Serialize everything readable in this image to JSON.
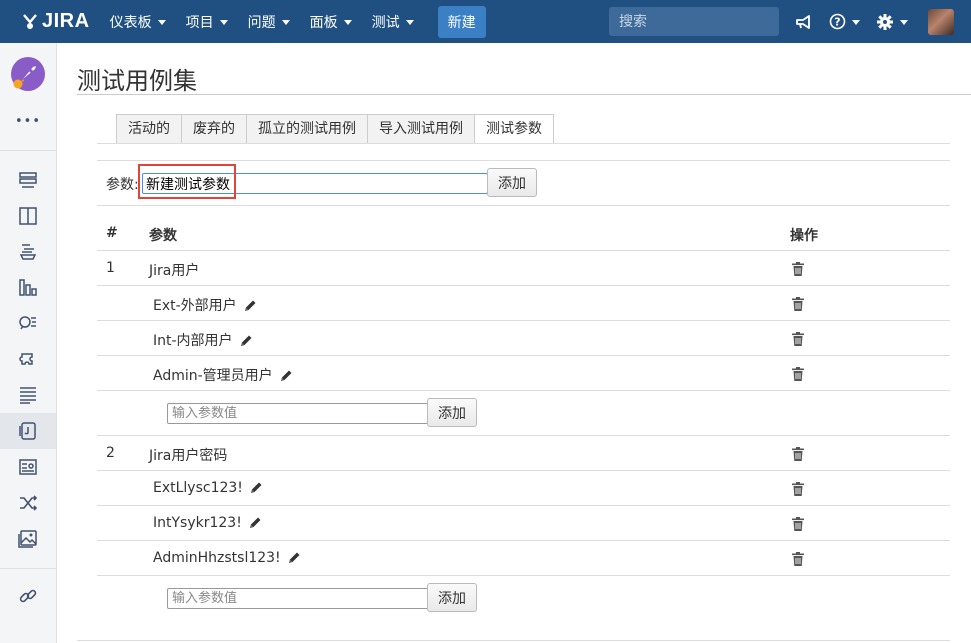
{
  "header": {
    "logo_text": "JIRA",
    "nav": [
      {
        "label": "仪表板"
      },
      {
        "label": "项目"
      },
      {
        "label": "问题"
      },
      {
        "label": "面板"
      },
      {
        "label": "测试"
      }
    ],
    "create_label": "新建",
    "search_placeholder": "搜索",
    "icons": [
      "megaphone-icon",
      "help-icon",
      "gear-icon",
      "user-avatar"
    ],
    "colors": {
      "bar": "#205081",
      "create": "#3b7fc4"
    }
  },
  "sidebar": {
    "more": "•••",
    "items": [
      "backlog-icon",
      "board-icon",
      "releases-icon",
      "reports-icon",
      "issues-search-icon",
      "components-icon",
      "test-plans-icon",
      "test-cases-icon",
      "test-runs-icon",
      "traceability-icon",
      "gallery-icon",
      "link-icon"
    ]
  },
  "page": {
    "title": "测试用例集",
    "tabs": [
      "活动的",
      "废弃的",
      "孤立的测试用例",
      "导入测试用例",
      "测试参数"
    ],
    "param_label": "参数:",
    "param_value": "新建测试参数",
    "add_label": "添加",
    "table": {
      "col_num": "#",
      "col_param": "参数",
      "col_action": "操作",
      "groups": [
        {
          "num": "1",
          "name": "Jira用户",
          "values": [
            "Ext-外部用户",
            "Int-内部用户",
            "Admin-管理员用户"
          ],
          "value_placeholder": "输入参数值",
          "add_label": "添加"
        },
        {
          "num": "2",
          "name": "Jira用户密码",
          "values": [
            "ExtLlysc123!",
            "IntYsykr123!",
            "AdminHhzstsl123!"
          ],
          "value_placeholder": "输入参数值",
          "add_label": "添加"
        }
      ]
    }
  }
}
